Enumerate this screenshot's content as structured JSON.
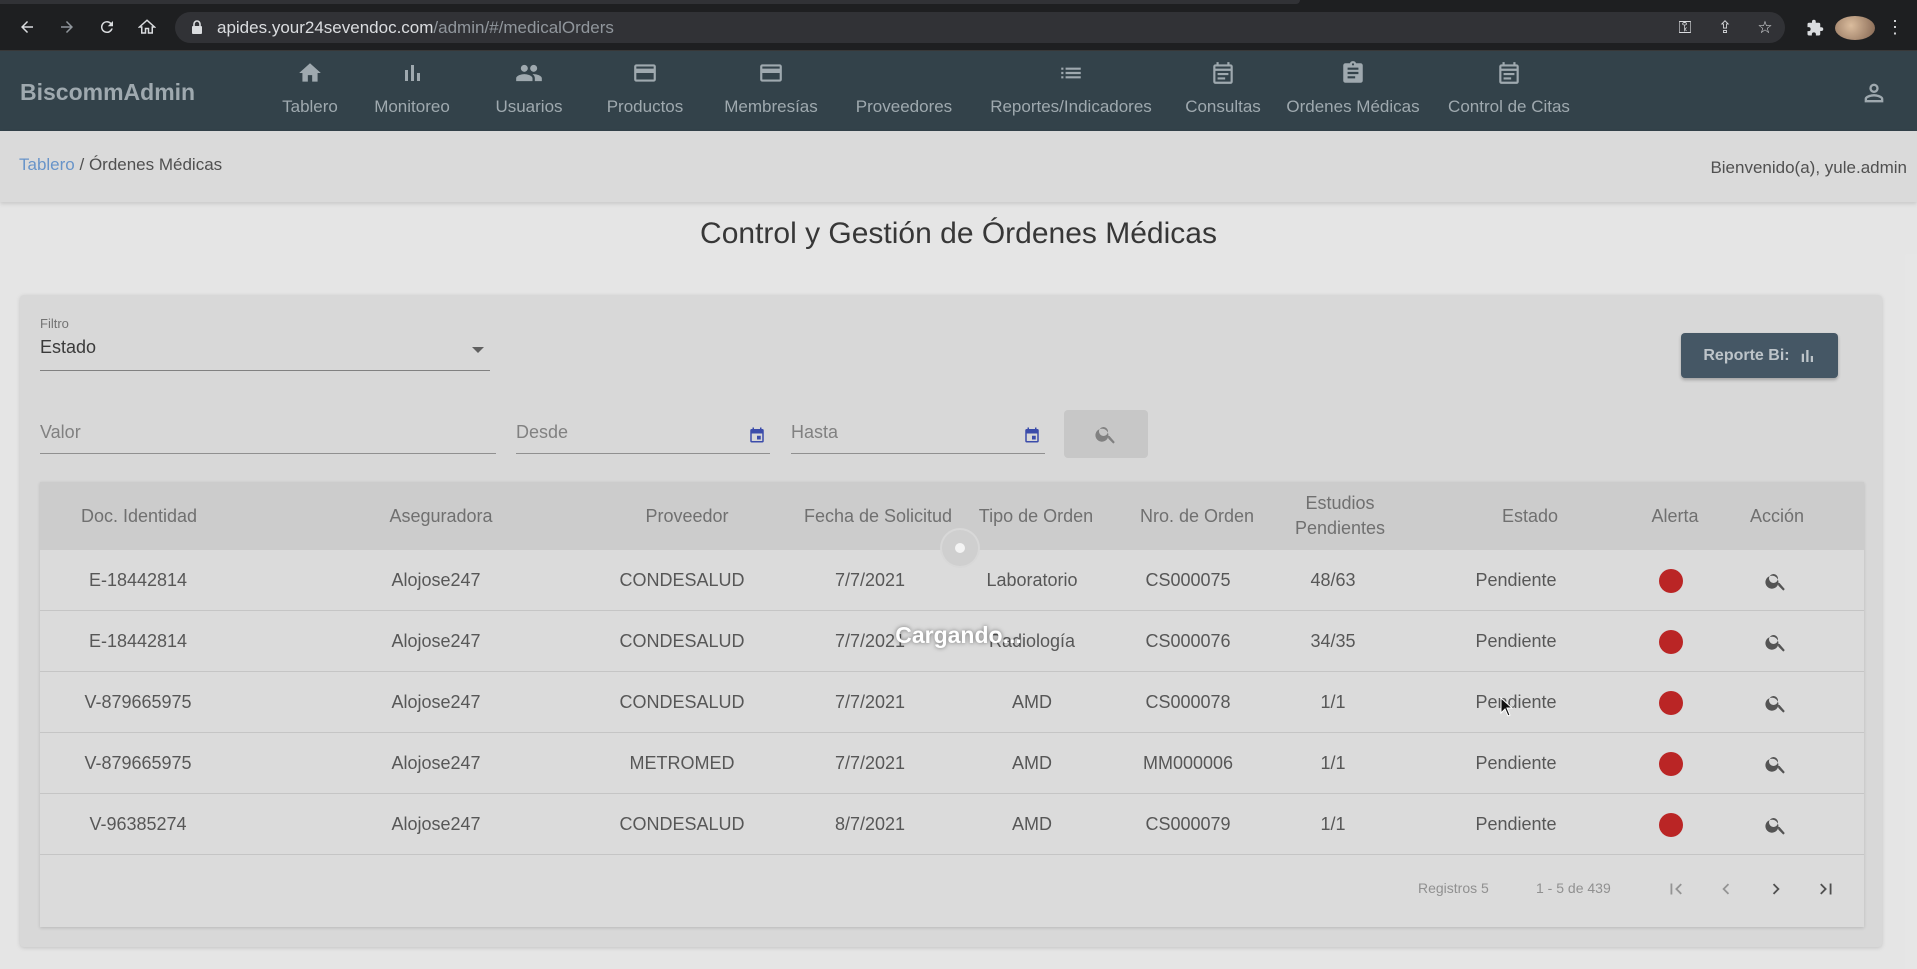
{
  "browser": {
    "url_host": "apides.your24sevendoc.com",
    "url_path": "/admin/#/medicalOrders"
  },
  "app": {
    "brand": "BiscommAdmin",
    "nav": [
      {
        "label": "Tablero",
        "icon": "home-icon"
      },
      {
        "label": "Monitoreo",
        "icon": "bar-chart-icon"
      },
      {
        "label": "Usuarios",
        "icon": "people-icon"
      },
      {
        "label": "Productos",
        "icon": "credit-card-icon"
      },
      {
        "label": "Membresías",
        "icon": "credit-card-icon"
      },
      {
        "label": "Proveedores",
        "icon": "none"
      },
      {
        "label": "Reportes/Indicadores",
        "icon": "list-icon"
      },
      {
        "label": "Consultas",
        "icon": "calendar-icon"
      },
      {
        "label": "Ordenes Médicas",
        "icon": "clipboard-icon"
      },
      {
        "label": "Control de Citas",
        "icon": "calendar-icon"
      }
    ]
  },
  "breadcrumb": {
    "root": "Tablero",
    "separator": " / ",
    "current": "Órdenes Médicas"
  },
  "welcome": "Bienvenido(a), yule.admin",
  "page": {
    "title": "Control y Gestión de Órdenes Médicas"
  },
  "filters": {
    "filter_label": "Filtro",
    "filter_value": "Estado",
    "valor_placeholder": "Valor",
    "desde_placeholder": "Desde",
    "hasta_placeholder": "Hasta",
    "report_button": "Reporte Bi:"
  },
  "table": {
    "columns": [
      "Doc. Identidad",
      "Aseguradora",
      "Proveedor",
      "Fecha de Solicitud",
      "Tipo de Orden",
      "Nro. de Orden",
      "Estudios Pendientes",
      "Estado",
      "Alerta",
      "Acción"
    ],
    "rows": [
      {
        "doc": "E-18442814",
        "aseguradora": "Alojose247",
        "proveedor": "CONDESALUD",
        "fecha": "7/7/2021",
        "tipo": "Laboratorio",
        "nro": "CS000075",
        "pendientes": "48/63",
        "estado": "Pendiente"
      },
      {
        "doc": "E-18442814",
        "aseguradora": "Alojose247",
        "proveedor": "CONDESALUD",
        "fecha": "7/7/2021",
        "tipo": "Radiología",
        "nro": "CS000076",
        "pendientes": "34/35",
        "estado": "Pendiente"
      },
      {
        "doc": "V-879665975",
        "aseguradora": "Alojose247",
        "proveedor": "CONDESALUD",
        "fecha": "7/7/2021",
        "tipo": "AMD",
        "nro": "CS000078",
        "pendientes": "1/1",
        "estado": "Pendiente"
      },
      {
        "doc": "V-879665975",
        "aseguradora": "Alojose247",
        "proveedor": "METROMED",
        "fecha": "7/7/2021",
        "tipo": "AMD",
        "nro": "MM000006",
        "pendientes": "1/1",
        "estado": "Pendiente"
      },
      {
        "doc": "V-96385274",
        "aseguradora": "Alojose247",
        "proveedor": "CONDESALUD",
        "fecha": "8/7/2021",
        "tipo": "AMD",
        "nro": "CS000079",
        "pendientes": "1/1",
        "estado": "Pendiente"
      }
    ],
    "alert_color": "#c62828"
  },
  "pagination": {
    "registros": "Registros 5",
    "range": "1 - 5 de 439"
  },
  "loading": {
    "text": "Cargando..."
  }
}
